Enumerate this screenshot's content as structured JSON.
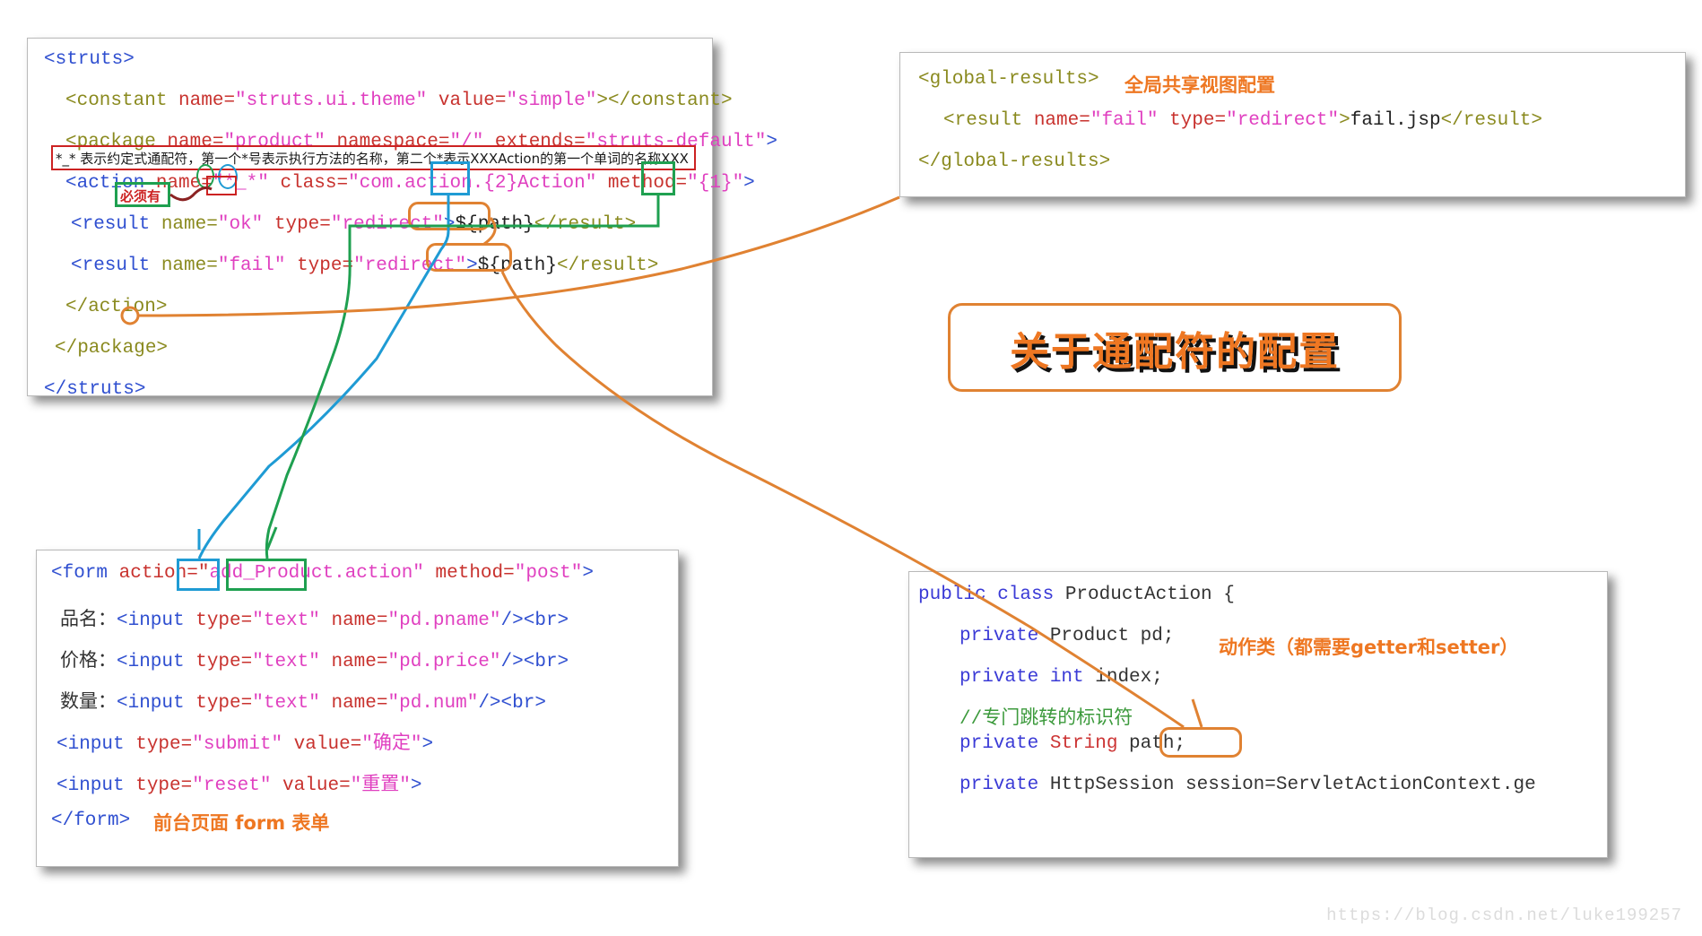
{
  "document": {
    "title": "关于通配符的配置",
    "watermark": "https://blog.csdn.net/luke199257"
  },
  "struts_panel": {
    "name": "struts-xml-code-panel",
    "lines": [
      "<struts>",
      "  <constant name=\"struts.ui.theme\" value=\"simple\"></constant>",
      "  <package name=\"product\" namespace=\"/\" extends=\"struts-default\">",
      "   <action name=\"*_*\" class=\"com.action.{2}Action\" method=\"{1}\">",
      "   <result name=\"ok\" type=\"redirect\">${path}</result>",
      "   <result name=\"fail\" type=\"redirect\">${path}</result>",
      "   </action>",
      "   </package>",
      "</struts>"
    ],
    "l1": "<struts>",
    "l2_a": "<constant ",
    "l2_b": "name=",
    "l2_c": "\"struts.ui.theme\"",
    "l2_d": " value=",
    "l2_e": "\"simple\"",
    "l2_f": "></constant>",
    "l3_a": "<package ",
    "l3_b": "name=",
    "l3_c": "\"product\"",
    "l3_d": " namespace=",
    "l3_e": "\"/\"",
    "l3_f": " extends=",
    "l3_g": "\"struts-default\"",
    "l3_h": ">",
    "l4_a": "<action ",
    "l4_b": "name=",
    "l4_c": "\"*_*\"",
    "l4_d": " class=",
    "l4_e": "\"com.action.{2}Action\"",
    "l4_f": " method=",
    "l4_g": "\"{1}\"",
    "l4_h": ">",
    "l5_a": "<result ",
    "l5_b": "name=",
    "l5_c": "\"ok\"",
    "l5_d": " type=",
    "l5_e": "\"redirect\"",
    "l5_f": ">",
    "l5_g": "${path}",
    "l5_h": "</result>",
    "l6_a": "<result ",
    "l6_b": "name=",
    "l6_c": "\"fail\"",
    "l6_d": " type=",
    "l6_e": "\"redirect\"",
    "l6_f": ">",
    "l6_g": "${path}",
    "l6_h": "</result>",
    "l7": "</action>",
    "l8": "</package>",
    "l9": "</struts>",
    "red_note": "*_* 表示约定式通配符，第一个*号表示执行方法的名称，第二个*表示XXXAction的第一个单词的名称XXX",
    "must_have_label": "必须有"
  },
  "global_panel": {
    "name": "global-results-code-panel",
    "l1_a": "<global-results>",
    "l1_note": "全局共享视图配置",
    "l2_a": "<result ",
    "l2_b": "name=",
    "l2_c": "\"fail\"",
    "l2_d": " type=",
    "l2_e": "\"redirect\"",
    "l2_f": ">",
    "l2_g": "fail.jsp",
    "l2_h": "</result>",
    "l3": "</global-results>"
  },
  "form_panel": {
    "name": "jsp-form-code-panel",
    "l1_a": "<form ",
    "l1_b": "action=",
    "l1_c": "\"",
    "l1_d": "add",
    "l1_e": "_",
    "l1_f": "Product",
    "l1_g": ".action\"",
    "l1_h": " method=",
    "l1_i": "\"post\"",
    "l1_j": ">",
    "l2_label": "品名：",
    "l2_a": "<input ",
    "l2_b": "type=",
    "l2_c": "\"text\"",
    "l2_d": " name=",
    "l2_e": "\"pd.pname\"",
    "l2_f": "/>",
    "l2_g": "<br>",
    "l3_label": "价格：",
    "l3_e": "\"pd.price\"",
    "l4_label": "数量：",
    "l4_e": "\"pd.num\"",
    "l5_a": "<input ",
    "l5_b": "type=",
    "l5_c": "\"submit\"",
    "l5_d": " value=",
    "l5_e": "\"确定\"",
    "l5_f": ">",
    "l6_c": "\"reset\"",
    "l6_e": "\"重置\"",
    "l7": "</form>",
    "note": "前台页面 form 表单"
  },
  "java_panel": {
    "name": "product-action-java-panel",
    "l1_a": "public class ",
    "l1_b": "ProductAction {",
    "l2_a": "private ",
    "l2_b": "Product pd;",
    "l3_a": "private int ",
    "l3_b": "index;",
    "l4_comment": "//专门跳转的标识符",
    "l5_a": "private ",
    "l5_b": "String",
    "l5_c": " path;",
    "l6_a": "private ",
    "l6_b": "HttpSession session=ServletActionContext.ge",
    "note": "动作类（都需要getter和setter）"
  },
  "colors": {
    "orange": "#ee7722",
    "orange_border": "#e08232",
    "red": "#cc2222",
    "blue": "#1f9bd4",
    "green": "#1fa050",
    "tag": "#2f4fd0",
    "tagname": "#8a8a1f",
    "attr": "#c8322e",
    "value": "#e040c0",
    "keyword": "#3a3ad6",
    "comment": "#3c9a3c"
  }
}
